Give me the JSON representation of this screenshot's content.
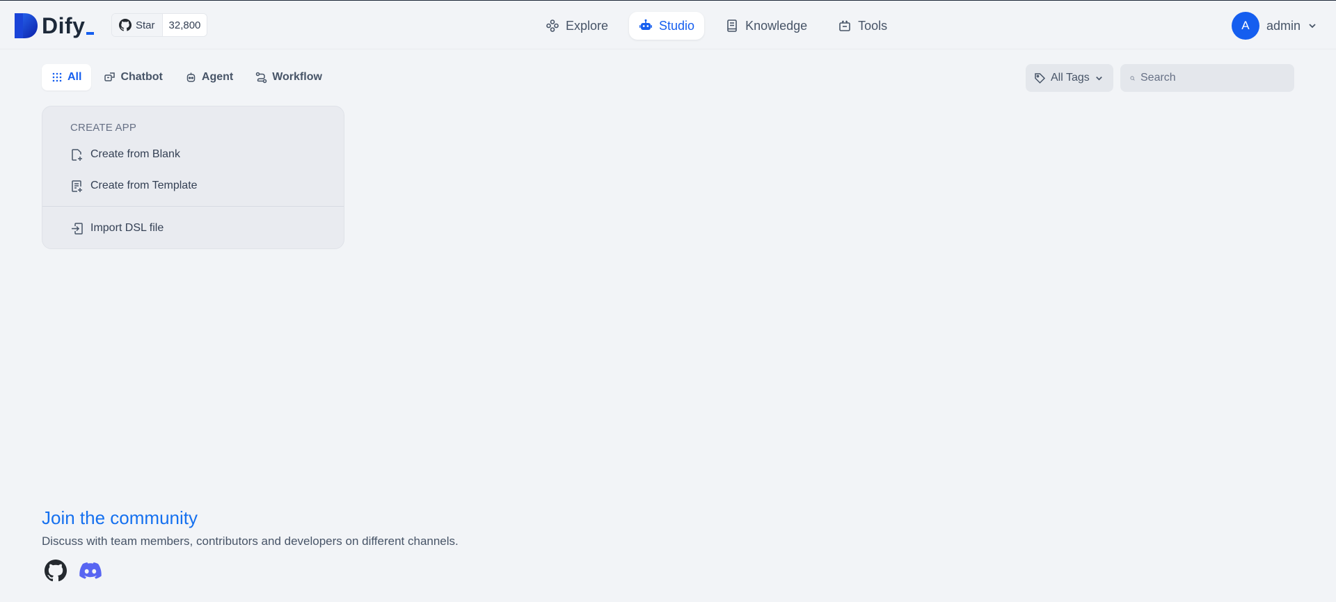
{
  "header": {
    "logo_text": "Dify",
    "github": {
      "star_label": "Star",
      "star_count": "32,800"
    },
    "nav": [
      {
        "label": "Explore",
        "icon": "explore-icon"
      },
      {
        "label": "Studio",
        "icon": "robot-icon",
        "active": true
      },
      {
        "label": "Knowledge",
        "icon": "book-icon"
      },
      {
        "label": "Tools",
        "icon": "toolbox-icon"
      }
    ],
    "account": {
      "avatar_initial": "A",
      "name": "admin"
    }
  },
  "filters": {
    "tabs": [
      {
        "label": "All",
        "icon": "grid-icon",
        "active": true
      },
      {
        "label": "Chatbot",
        "icon": "chatbot-icon"
      },
      {
        "label": "Agent",
        "icon": "agent-icon"
      },
      {
        "label": "Workflow",
        "icon": "workflow-icon"
      }
    ],
    "tags_label": "All Tags",
    "search_placeholder": "Search"
  },
  "create_app": {
    "title": "CREATE APP",
    "items": [
      {
        "label": "Create from Blank",
        "icon": "file-plus-icon"
      },
      {
        "label": "Create from Template",
        "icon": "template-icon"
      },
      {
        "label": "Import DSL file",
        "icon": "import-icon"
      }
    ]
  },
  "community": {
    "title": "Join the community",
    "description": "Discuss with team members, contributors and developers on different channels."
  },
  "colors": {
    "accent": "#155eef",
    "link": "#1570ef",
    "background": "#f2f4f7",
    "discord": "#5865f2"
  }
}
